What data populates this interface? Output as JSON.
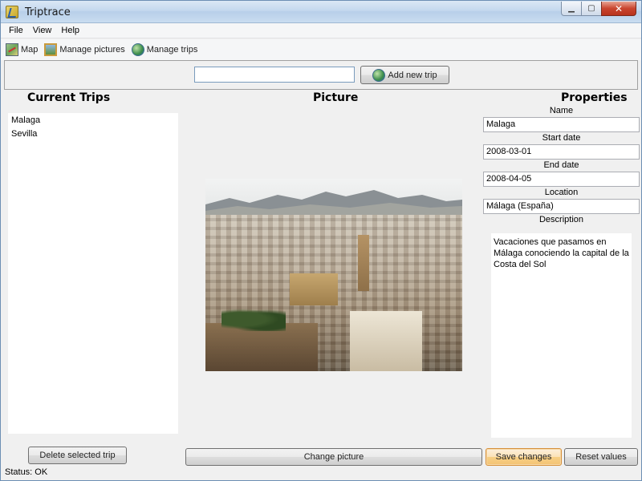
{
  "window": {
    "title": "Triptrace"
  },
  "menu": [
    "File",
    "View",
    "Help"
  ],
  "toolbar": {
    "map": "Map",
    "manage_pictures": "Manage pictures",
    "manage_trips": "Manage trips"
  },
  "add_trip": {
    "input_value": "",
    "button_label": "Add new trip"
  },
  "trips": {
    "heading": "Current Trips",
    "items": [
      "Malaga",
      "Sevilla"
    ],
    "delete_label": "Delete selected trip"
  },
  "picture": {
    "heading": "Picture",
    "change_label": "Change picture"
  },
  "properties": {
    "heading": "Properties",
    "name_label": "Name",
    "name_value": "Malaga",
    "start_label": "Start date",
    "start_value": "2008-03-01",
    "end_label": "End date",
    "end_value": "2008-04-05",
    "location_label": "Location",
    "location_value": "Málaga (España)",
    "description_label": "Description",
    "description_value": "Vacaciones que pasamos en Málaga conociendo la capital de la Costa del Sol",
    "save_label": "Save changes",
    "reset_label": "Reset values"
  },
  "status": {
    "text": "Status: OK"
  }
}
